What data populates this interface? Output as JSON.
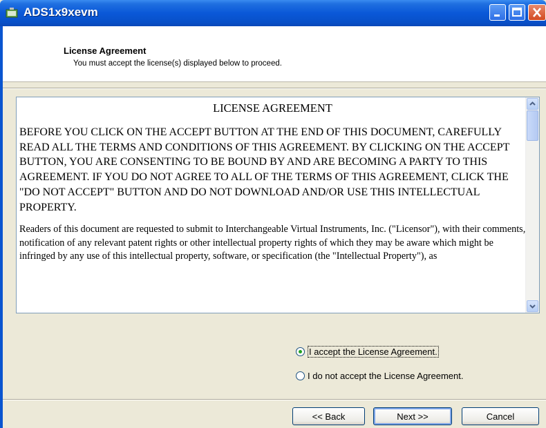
{
  "window": {
    "title": "ADS1x9xevm"
  },
  "header": {
    "title": "License Agreement",
    "subtitle": "You must accept the license(s) displayed below to proceed."
  },
  "license": {
    "heading": "LICENSE AGREEMENT",
    "paragraph1": "BEFORE YOU CLICK ON THE ACCEPT BUTTON AT THE END OF THIS DOCUMENT, CAREFULLY READ ALL THE TERMS AND CONDITIONS OF THIS AGREEMENT.  BY CLICKING ON THE ACCEPT BUTTON, YOU ARE CONSENTING TO BE BOUND BY AND ARE BECOMING A PARTY TO THIS AGREEMENT.  IF YOU DO NOT AGREE TO ALL OF THE TERMS OF THIS AGREEMENT, CLICK THE \"DO NOT ACCEPT\" BUTTON AND DO NOT DOWNLOAD AND/OR USE THIS INTELLECTUAL PROPERTY.",
    "paragraph2": "Readers of this document are requested to submit to Interchangeable Virtual Instruments, Inc. (\"Licensor\"), with their comments, notification of any relevant patent rights or other intellectual property rights of which they may be aware which might be infringed by any use of this intellectual property, software, or specification (the \"Intellectual Property\"), as"
  },
  "options": {
    "accept_label": "I accept the License Agreement.",
    "decline_label": "I do not accept the License Agreement.",
    "selected": "accept"
  },
  "buttons": {
    "back_label": "<< Back",
    "next_label": "Next >>",
    "cancel_label": "Cancel"
  },
  "colors": {
    "titlebar": "#0a58d8",
    "accent_radio": "#21a121"
  }
}
